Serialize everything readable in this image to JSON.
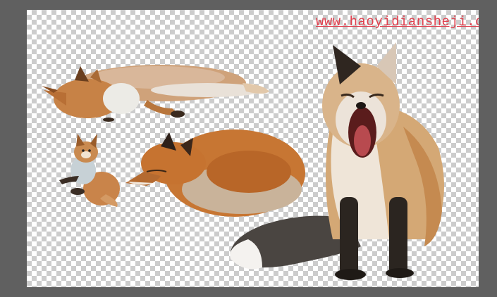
{
  "watermark": {
    "text": "www.haoyidiansheji.com",
    "color": "#e0404e"
  },
  "canvas": {
    "background": "transparency-checkerboard"
  },
  "layers": [
    {
      "name": "fox-lying"
    },
    {
      "name": "fox-kit-small"
    },
    {
      "name": "fox-curled-sleeping"
    },
    {
      "name": "fox-sitting-yawning"
    }
  ],
  "colors": {
    "workspace": "#606060",
    "checker_light": "#ffffff",
    "checker_dark": "#cccccc",
    "fox_orange": "#c87a3a",
    "fox_light": "#e8d8c4",
    "fox_dark": "#2b2520"
  }
}
